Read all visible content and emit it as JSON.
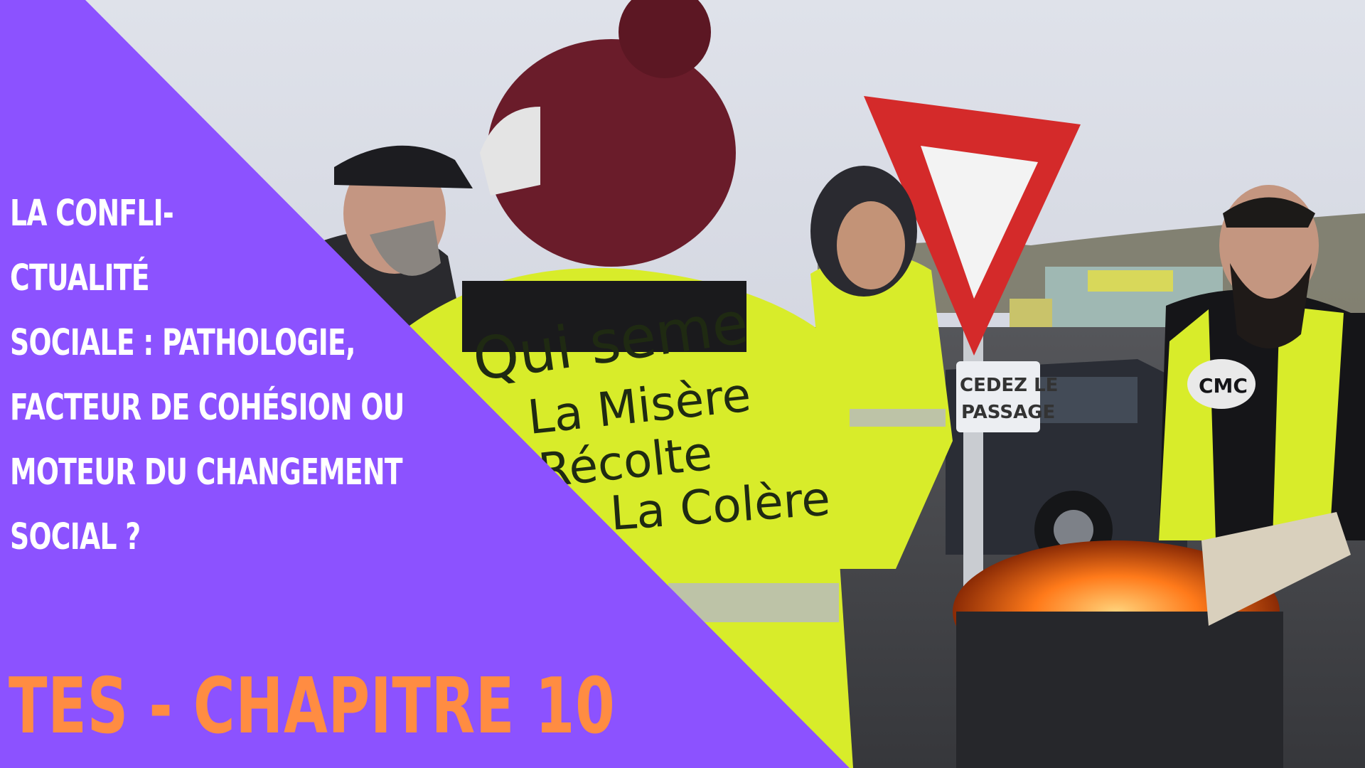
{
  "title_lines": [
    "La confli-",
    "ctualité",
    "sociale : pathologie,",
    "facteur de cohésion ou",
    "moteur du changement",
    "social ?"
  ],
  "chapter_label": "TES - CHAPITRE 10",
  "photo": {
    "vest_text": [
      "Qui seme",
      "La Misère",
      "Récolte",
      "La Colère !!"
    ],
    "sign_text": [
      "CEDEZ LE",
      "PASSAGE"
    ],
    "sweater_logo": "CMC"
  },
  "colors": {
    "panel": "#8c52ff",
    "title": "#ffffff",
    "chapter": "#ff8c42",
    "vest": "#d8ec2a"
  }
}
